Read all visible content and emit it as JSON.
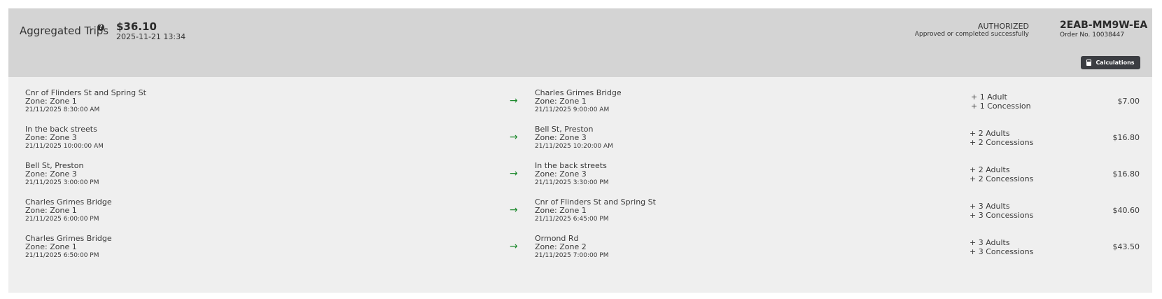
{
  "header": {
    "title": "Aggregated Trips",
    "help_icon": "?",
    "amount": "$36.10",
    "datetime": "2025-11-21 13:34",
    "status": "AUTHORIZED",
    "status_detail": "Approved or completed successfully",
    "order_code": "2EAB-MM9W-EA",
    "order_number": "Order No. 10038447",
    "calc_button": "Calculations",
    "calc_icon": "calculator-icon"
  },
  "colors": {
    "arrow": "#1e8a2e",
    "header_bg": "#d4d4d4",
    "card_bg": "#efefef",
    "button_bg": "#3b3d42"
  },
  "arrow_glyph": "→",
  "trips": [
    {
      "from": {
        "name": "Cnr of Flinders St and Spring St",
        "zone": "Zone: Zone 1",
        "time": "21/11/2025 8:30:00 AM"
      },
      "to": {
        "name": "Charles Grimes Bridge",
        "zone": "Zone: Zone 1",
        "time": "21/11/2025 9:00:00 AM"
      },
      "adults": "+ 1 Adult",
      "concessions": "+ 1 Concession",
      "price": "$7.00"
    },
    {
      "from": {
        "name": "In the back streets",
        "zone": "Zone: Zone 3",
        "time": "21/11/2025 10:00:00 AM"
      },
      "to": {
        "name": "Bell St, Preston",
        "zone": "Zone: Zone 3",
        "time": "21/11/2025 10:20:00 AM"
      },
      "adults": "+ 2 Adults",
      "concessions": "+ 2 Concessions",
      "price": "$16.80"
    },
    {
      "from": {
        "name": "Bell St, Preston",
        "zone": "Zone: Zone 3",
        "time": "21/11/2025 3:00:00 PM"
      },
      "to": {
        "name": "In the back streets",
        "zone": "Zone: Zone 3",
        "time": "21/11/2025 3:30:00 PM"
      },
      "adults": "+ 2 Adults",
      "concessions": "+ 2 Concessions",
      "price": "$16.80"
    },
    {
      "from": {
        "name": "Charles Grimes Bridge",
        "zone": "Zone: Zone 1",
        "time": "21/11/2025 6:00:00 PM"
      },
      "to": {
        "name": "Cnr of Flinders St and Spring St",
        "zone": "Zone: Zone 1",
        "time": "21/11/2025 6:45:00 PM"
      },
      "adults": "+ 3 Adults",
      "concessions": "+ 3 Concessions",
      "price": "$40.60"
    },
    {
      "from": {
        "name": "Charles Grimes Bridge",
        "zone": "Zone: Zone 1",
        "time": "21/11/2025 6:50:00 PM"
      },
      "to": {
        "name": "Ormond Rd",
        "zone": "Zone: Zone 2",
        "time": "21/11/2025 7:00:00 PM"
      },
      "adults": "+ 3 Adults",
      "concessions": "+ 3 Concessions",
      "price": "$43.50"
    }
  ]
}
